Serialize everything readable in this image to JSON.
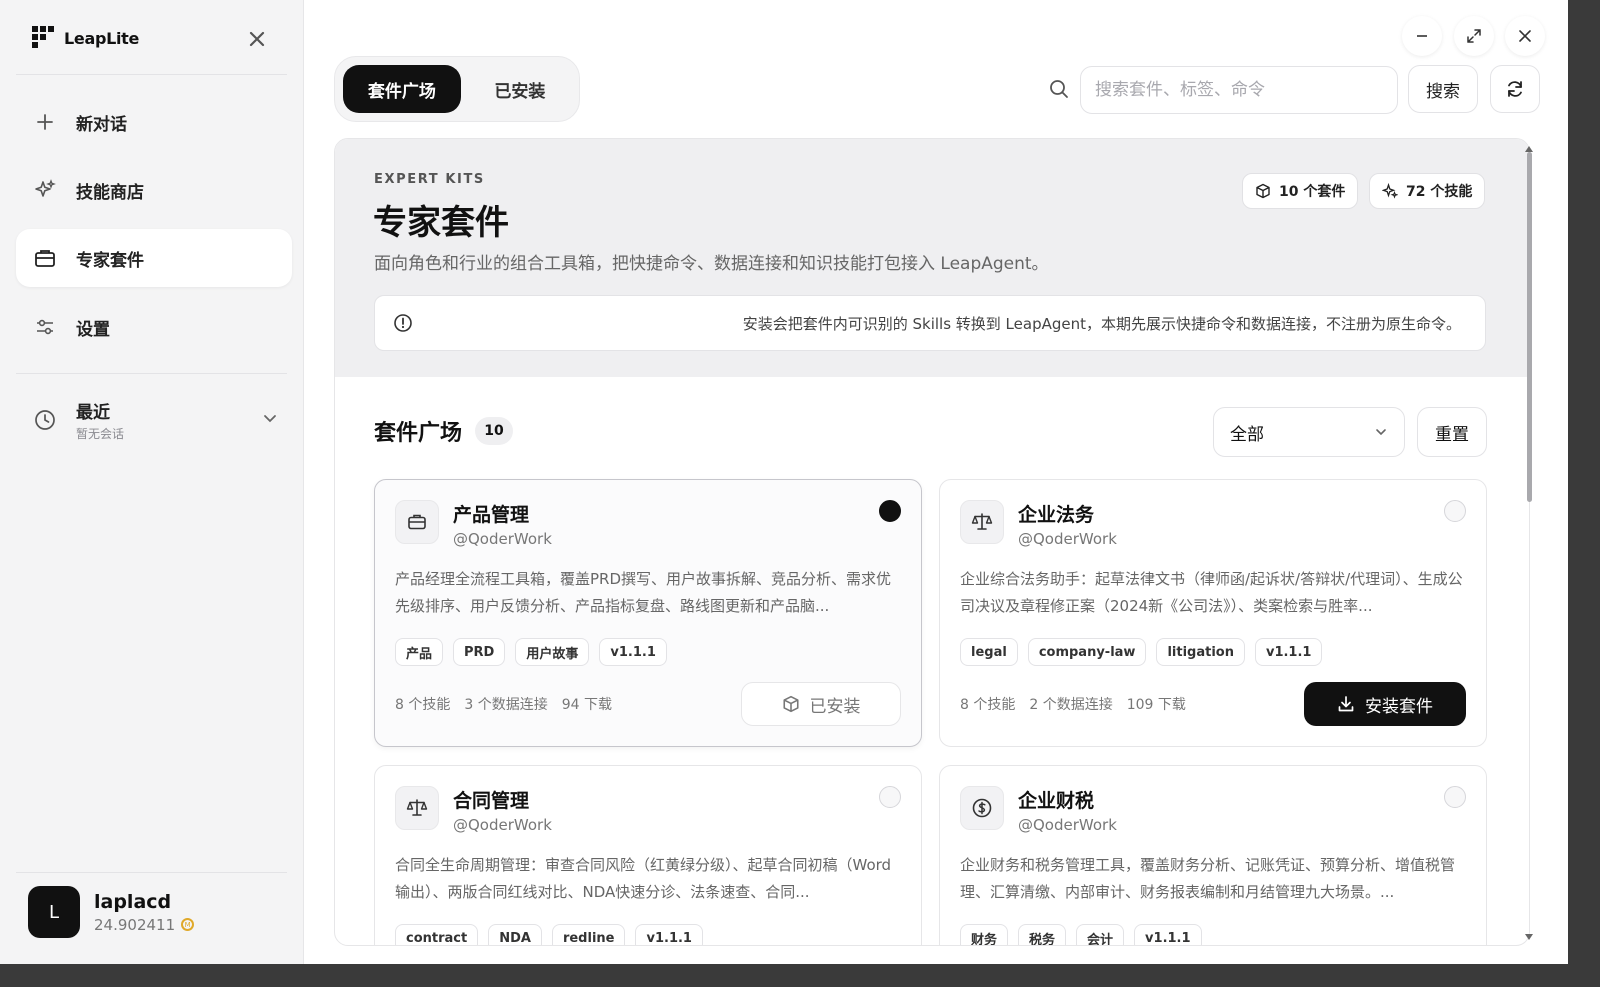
{
  "app": {
    "brand": "LeapLite"
  },
  "sidebar": {
    "items": [
      {
        "label": "新对话",
        "icon": "plus-icon"
      },
      {
        "label": "技能商店",
        "icon": "sparkles-icon"
      },
      {
        "label": "专家套件",
        "icon": "briefcase-icon"
      },
      {
        "label": "设置",
        "icon": "sliders-icon"
      }
    ],
    "recent": {
      "title": "最近",
      "subtitle": "暂无会话"
    },
    "user": {
      "initial": "L",
      "name": "laplacd",
      "balance": "24.902411"
    }
  },
  "tabs": [
    {
      "label": "套件广场"
    },
    {
      "label": "已安装"
    }
  ],
  "search": {
    "placeholder": "搜索套件、标签、命令",
    "button": "搜索"
  },
  "hero": {
    "eyebrow": "EXPERT KITS",
    "title": "专家套件",
    "description": "面向角色和行业的组合工具箱，把快捷命令、数据连接和知识技能打包接入 LeapAgent。",
    "kits_stat": "10 个套件",
    "skills_stat": "72 个技能",
    "notice": "安装会把套件内可识别的 Skills 转换到 LeapAgent，本期先展示快捷命令和数据连接，不注册为原生命令。"
  },
  "market": {
    "title": "套件广场",
    "count": "10",
    "filter": "全部",
    "reset": "重置"
  },
  "cards": [
    {
      "title": "产品管理",
      "author": "@QoderWork",
      "icon": "briefcase-icon",
      "selected": true,
      "description": "产品经理全流程工具箱，覆盖PRD撰写、用户故事拆解、竞品分析、需求优先级排序、用户反馈分析、产品指标复盘、路线图更新和产品脑...",
      "tags": [
        "产品",
        "PRD",
        "用户故事",
        "v1.1.1"
      ],
      "skills": "8 个技能",
      "connections": "3 个数据连接",
      "downloads": "94 下载",
      "action": "已安装"
    },
    {
      "title": "企业法务",
      "author": "@QoderWork",
      "icon": "scale-icon",
      "selected": false,
      "description": "企业综合法务助手：起草法律文书（律师函/起诉状/答辩状/代理词）、生成公司决议及章程修正案（2024新《公司法》）、类案检索与胜率...",
      "tags": [
        "legal",
        "company-law",
        "litigation",
        "v1.1.1"
      ],
      "skills": "8 个技能",
      "connections": "2 个数据连接",
      "downloads": "109 下载",
      "action": "安装套件"
    },
    {
      "title": "合同管理",
      "author": "@QoderWork",
      "icon": "scale-icon",
      "selected": false,
      "description": "合同全生命周期管理：审查合同风险（红黄绿分级）、起草合同初稿（Word输出）、两版合同红线对比、NDA快速分诊、法条速查、合同...",
      "tags": [
        "contract",
        "NDA",
        "redline",
        "v1.1.1"
      ]
    },
    {
      "title": "企业财税",
      "author": "@QoderWork",
      "icon": "dollar-icon",
      "selected": false,
      "description": "企业财务和税务管理工具，覆盖财务分析、记账凭证、预算分析、增值税管理、汇算清缴、内部审计、财务报表编制和月结管理九大场景。...",
      "tags": [
        "财务",
        "税务",
        "会计",
        "v1.1.1"
      ]
    }
  ]
}
